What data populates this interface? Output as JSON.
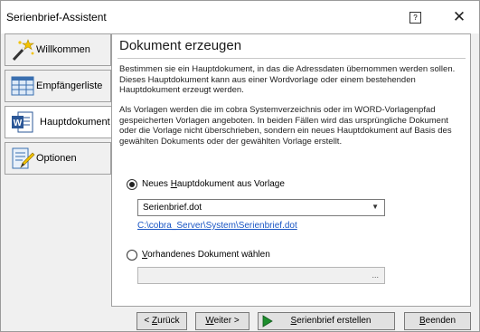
{
  "window": {
    "title": "Serienbrief-Assistent",
    "help_glyph": "?",
    "close_glyph": "✕"
  },
  "sidebar": {
    "items": [
      {
        "label": "Willkommen",
        "icon": "magic-wand-icon",
        "active": false
      },
      {
        "label": "Empfängerliste",
        "icon": "table-grid-icon",
        "active": false
      },
      {
        "label": "Hauptdokument",
        "icon": "word-document-icon",
        "active": true
      },
      {
        "label": "Optionen",
        "icon": "pencil-document-icon",
        "active": false
      }
    ]
  },
  "main": {
    "title": "Dokument erzeugen",
    "paragraph1": "Bestimmen sie ein Hauptdokument, in das die Adressdaten übernommen werden sollen. Dieses Hauptdokument kann aus einer Wordvorlage oder einem bestehenden Hauptdokument erzeugt werden.",
    "paragraph2": "Als Vorlagen werden die im cobra Systemverzeichnis oder im WORD-Vorlagenpfad gespeicherten Vorlagen angeboten. In beiden Fällen wird das ursprüngliche Dokument oder die Vorlage nicht überschrieben, sondern ein neues Hauptdokument auf Basis des gewählten Dokuments oder der gewählten Vorlage erstellt.",
    "option_template": {
      "label_pre": "Neues ",
      "label_u": "H",
      "label_post": "auptdokument aus Vorlage",
      "checked": true
    },
    "template_select": {
      "value": "Serienbrief.dot",
      "arrow": "▼"
    },
    "template_path": "C:\\cobra_Server\\System\\Serienbrief.dot",
    "option_existing": {
      "label_pre": "",
      "label_u": "V",
      "label_post": "orhandenes Dokument wählen",
      "checked": false
    },
    "existing_path": {
      "value": "",
      "browse": "..."
    }
  },
  "footer": {
    "back": {
      "pre": "< ",
      "u": "Z",
      "post": "urück"
    },
    "next": {
      "pre": "",
      "u": "W",
      "post": "eiter >"
    },
    "create": {
      "pre": "",
      "u": "S",
      "post": "erienbrief erstellen"
    },
    "finish": {
      "pre": "",
      "u": "B",
      "post": "eenden"
    }
  },
  "colors": {
    "link": "#1a56c4",
    "accent_green": "#1e8e2e"
  }
}
